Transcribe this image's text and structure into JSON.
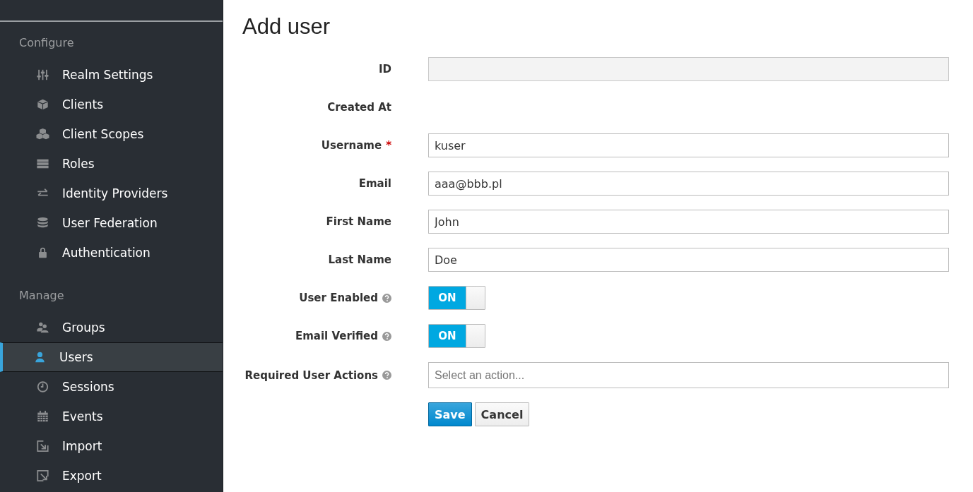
{
  "sidebar": {
    "sections": [
      {
        "title": "Configure",
        "items": [
          {
            "label": "Realm Settings",
            "selected": false
          },
          {
            "label": "Clients",
            "selected": false
          },
          {
            "label": "Client Scopes",
            "selected": false
          },
          {
            "label": "Roles",
            "selected": false
          },
          {
            "label": "Identity Providers",
            "selected": false
          },
          {
            "label": "User Federation",
            "selected": false
          },
          {
            "label": "Authentication",
            "selected": false
          }
        ]
      },
      {
        "title": "Manage",
        "items": [
          {
            "label": "Groups",
            "selected": false
          },
          {
            "label": "Users",
            "selected": true
          },
          {
            "label": "Sessions",
            "selected": false
          },
          {
            "label": "Events",
            "selected": false
          },
          {
            "label": "Import",
            "selected": false
          },
          {
            "label": "Export",
            "selected": false
          }
        ]
      }
    ]
  },
  "page": {
    "title": "Add user"
  },
  "form": {
    "fields": [
      {
        "kind": "input",
        "label": "ID",
        "disabled": true,
        "help": false
      },
      {
        "kind": "text",
        "label": "Created At",
        "help": false
      },
      {
        "kind": "input",
        "label": "Username",
        "required_mark": "*",
        "value": "kuser",
        "disabled": false,
        "help": false
      },
      {
        "kind": "input",
        "label": "Email",
        "value": "aaa@bbb.pl",
        "disabled": false,
        "help": false
      },
      {
        "kind": "input",
        "label": "First Name",
        "value": "John",
        "disabled": false,
        "help": false
      },
      {
        "kind": "input",
        "label": "Last Name",
        "value": "Doe",
        "disabled": false,
        "help": false
      },
      {
        "kind": "switch",
        "label": "User Enabled",
        "on": true,
        "state_label": "ON",
        "help": true
      },
      {
        "kind": "switch",
        "label": "Email Verified",
        "on": true,
        "state_label": "ON",
        "help": true
      },
      {
        "kind": "select",
        "label": "Required User Actions",
        "placeholder": "Select an action...",
        "help": true
      }
    ],
    "buttons": [
      {
        "label": "Save",
        "kind": "primary"
      },
      {
        "label": "Cancel",
        "kind": "default"
      }
    ]
  }
}
